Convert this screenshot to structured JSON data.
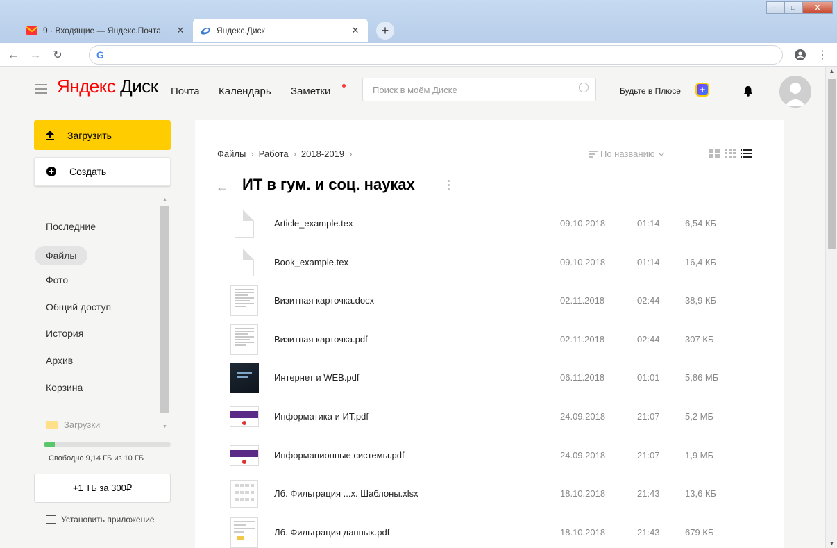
{
  "browser": {
    "tabs": [
      {
        "label": "9 · Входящие — Яндекс.Почта",
        "icon": "yandex-mail-icon",
        "active": false
      },
      {
        "label": "Яндекс.Диск",
        "icon": "yandex-disk-icon",
        "active": true
      }
    ],
    "close_glyph": "✕",
    "new_tab_glyph": "+",
    "window_buttons": {
      "minimize": "–",
      "maximize": "□",
      "close": "X"
    }
  },
  "header": {
    "logo_brand": "Яндекс",
    "logo_product": "Диск",
    "nav": [
      "Почта",
      "Календарь",
      "Заметки"
    ],
    "search_placeholder": "Поиск в моём Диске",
    "plus_text": "Будьте в Плюсе"
  },
  "sidebar": {
    "upload_label": "Загрузить",
    "create_label": "Создать",
    "items": [
      "Последние",
      "Файлы",
      "Фото",
      "Общий доступ",
      "История",
      "Архив",
      "Корзина"
    ],
    "selected": "Файлы",
    "folder": "Загрузки",
    "storage_used_fraction": 0.086,
    "storage_text": "Свободно 9,14 ГБ из 10 ГБ",
    "buy_label": "+1 ТБ за 300₽",
    "install_label": "Установить приложение"
  },
  "main": {
    "breadcrumbs": [
      "Файлы",
      "Работа",
      "2018-2019"
    ],
    "crumb_sep": "›",
    "sort_label": "По названию",
    "title": "ИТ в гум. и соц. науках",
    "files": [
      {
        "name": "Article_example.tex",
        "date": "09.10.2018",
        "time": "01:14",
        "size": "6,54 КБ",
        "thumb": "blank"
      },
      {
        "name": "Book_example.tex",
        "date": "09.10.2018",
        "time": "01:14",
        "size": "16,4 КБ",
        "thumb": "blank"
      },
      {
        "name": "Визитная карточка.docx",
        "date": "02.11.2018",
        "time": "02:44",
        "size": "38,9 КБ",
        "thumb": "text"
      },
      {
        "name": "Визитная карточка.pdf",
        "date": "02.11.2018",
        "time": "02:44",
        "size": "307 КБ",
        "thumb": "text"
      },
      {
        "name": "Интернет и WEB.pdf",
        "date": "06.11.2018",
        "time": "01:01",
        "size": "5,86 МБ",
        "thumb": "dark"
      },
      {
        "name": "Информатика и ИТ.pdf",
        "date": "24.09.2018",
        "time": "21:07",
        "size": "5,2 МБ",
        "thumb": "purple"
      },
      {
        "name": "Информационные системы.pdf",
        "date": "24.09.2018",
        "time": "21:07",
        "size": "1,9 МБ",
        "thumb": "purple"
      },
      {
        "name": "Лб. Фильтрация ...х. Шаблоны.xlsx",
        "date": "18.10.2018",
        "time": "21:43",
        "size": "13,6 КБ",
        "thumb": "sheet"
      },
      {
        "name": "Лб. Фильтрация данных.pdf",
        "date": "18.10.2018",
        "time": "21:43",
        "size": "679 КБ",
        "thumb": "pdf2"
      }
    ]
  }
}
